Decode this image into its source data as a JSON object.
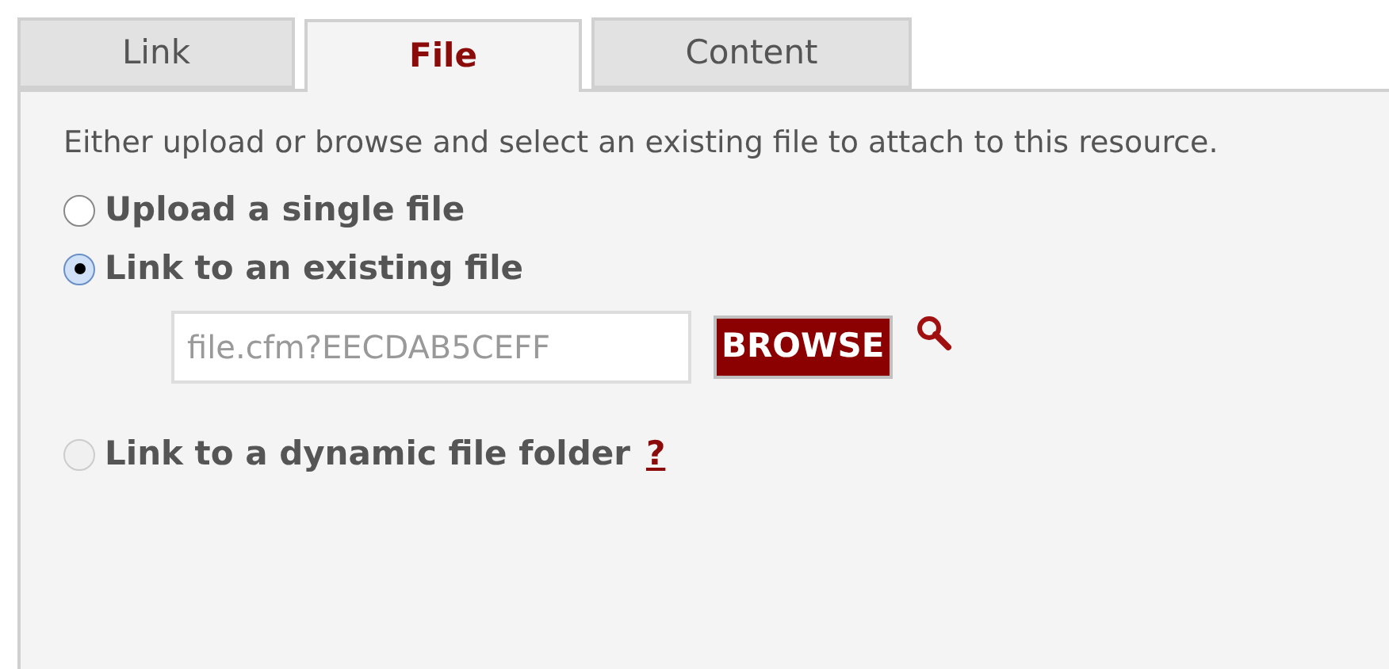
{
  "tabs": [
    {
      "label": "Link",
      "selected": false
    },
    {
      "label": "File",
      "selected": true
    },
    {
      "label": "Content",
      "selected": false
    }
  ],
  "description": "Either upload or browse and select an existing file to attach to this resource.",
  "options": [
    {
      "label": "Upload a single file",
      "selected": false,
      "disabled": false
    },
    {
      "label": "Link to an existing file",
      "selected": true,
      "disabled": false,
      "file_field": {
        "value": "file.cfm?EECDAB5CEFF",
        "button": "BROWSE"
      }
    },
    {
      "label": "Link to a dynamic file folder",
      "selected": false,
      "disabled": true,
      "help": "?"
    }
  ]
}
